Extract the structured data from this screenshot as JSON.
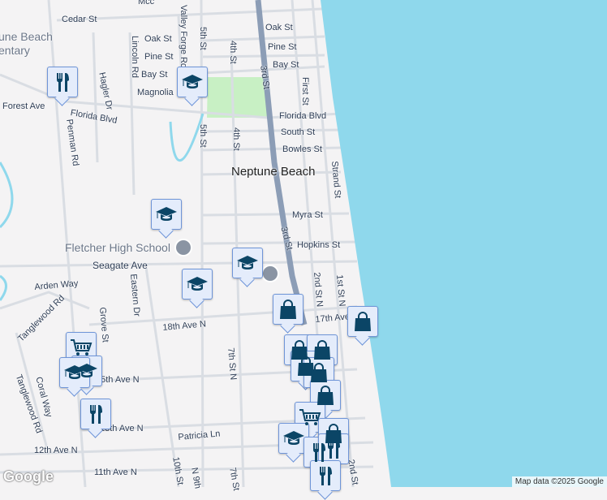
{
  "map": {
    "place": "Neptune Beach",
    "attribution": "Map data ©2025 Google",
    "logo": "Google",
    "colors": {
      "ocean": "#8fd8ec",
      "land": "#f4f3f4",
      "road": "#d9dde3",
      "highway": "#8c9db6",
      "park": "#c8f0c4",
      "marker_fill": "#e4ecfb",
      "marker_icon": "#0b4566"
    }
  },
  "labels": [
    "Cedar St",
    "Oak St",
    "Pine St",
    "Bay St",
    "Magnolia",
    "Lincoln Rd",
    "Valley Forge Rd",
    "5th St",
    "4th St",
    "Forest Ave",
    "Florida Blvd",
    "Hagler Dr",
    "Penman Rd",
    "3rd St",
    "Oak St",
    "Pine St",
    "Bay St",
    "First St",
    "Florida Blvd",
    "South St",
    "Bowles St",
    "5th St",
    "4th St",
    "Strand St",
    "Myra St",
    "Hopkins St",
    "3rd St",
    "Seagate Ave",
    "Arden Way",
    "Tanglewood Rd",
    "Eastern Dr",
    "Grove St",
    "18th Ave N",
    "7th St N",
    "2nd St N",
    "1st St N",
    "17th Ave",
    "15th Ave N",
    "Coral Way",
    "13th Ave N",
    "Patricia Ln",
    "12th Ave N",
    "11th Ave N",
    "10th St",
    "N 9th",
    "7th St",
    "2nd St",
    "Tanglewood Rd",
    "Mcc"
  ],
  "pois": {
    "cemetery": "une Beach\nentary",
    "school": "Fletcher High School"
  },
  "markers": [
    "restaurant",
    "school",
    "school",
    "school",
    "school",
    "shopping",
    "shopping",
    "shopping",
    "shopping",
    "grocery",
    "school",
    "restaurant",
    "grocery",
    "school",
    "restaurant"
  ]
}
